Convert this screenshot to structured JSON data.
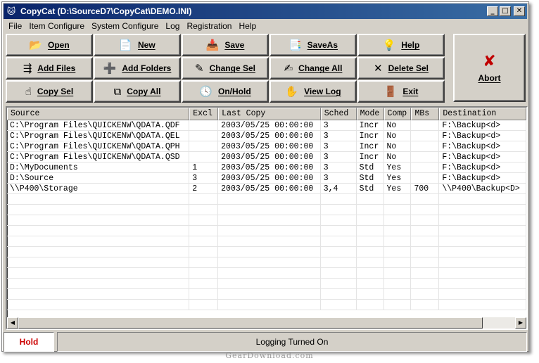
{
  "window": {
    "title": "CopyCat  (D:\\SourceD7\\CopyCat\\DEMO.INI)",
    "minimize": "_",
    "maximize": "□",
    "close": "✕"
  },
  "menu": [
    "File",
    "Item Configure",
    "System Configure",
    "Log",
    "Registration",
    "Help"
  ],
  "toolbar": {
    "open": "Open",
    "new": "New",
    "save": "Save",
    "saveas": "SaveAs",
    "help": "Help",
    "add_files": "Add Files",
    "add_folders": "Add Folders",
    "change_sel": "Change Sel",
    "change_all": "Change All",
    "delete_sel": "Delete Sel",
    "copy_sel": "Copy Sel",
    "copy_all": "Copy All",
    "onhold": "On/Hold",
    "view_log": "View Log",
    "exit": "Exit",
    "abort": "Abort"
  },
  "list": {
    "headers": [
      "Source",
      "Excl",
      "Last Copy",
      "Sched",
      "Mode",
      "Comp",
      "MBs",
      "Destination"
    ],
    "rows": [
      [
        "C:\\Program Files\\QUICKENW\\QDATA.QDF",
        "",
        "2003/05/25 00:00:00",
        "3",
        "Incr",
        "No",
        "",
        "F:\\Backup<d>"
      ],
      [
        "C:\\Program Files\\QUICKENW\\QDATA.QEL",
        "",
        "2003/05/25 00:00:00",
        "3",
        "Incr",
        "No",
        "",
        "F:\\Backup<d>"
      ],
      [
        "C:\\Program Files\\QUICKENW\\QDATA.QPH",
        "",
        "2003/05/25 00:00:00",
        "3",
        "Incr",
        "No",
        "",
        "F:\\Backup<d>"
      ],
      [
        "C:\\Program Files\\QUICKENW\\QDATA.QSD",
        "",
        "2003/05/25 00:00:00",
        "3",
        "Incr",
        "No",
        "",
        "F:\\Backup<d>"
      ],
      [
        "D:\\MyDocuments",
        "1",
        "2003/05/25 00:00:00",
        "3",
        "Std",
        "Yes",
        "",
        "F:\\Backup<d>"
      ],
      [
        "D:\\Source",
        "3",
        "2003/05/25 00:00:00",
        "3",
        "Std",
        "Yes",
        "",
        "F:\\Backup<d>"
      ],
      [
        "\\\\P400\\Storage",
        "2",
        "2003/05/25 00:00:00",
        "3,4",
        "Std",
        "Yes",
        "700",
        "\\\\P400\\Backup<D>"
      ]
    ]
  },
  "status": {
    "hold": "Hold",
    "message": "Logging Turned On"
  },
  "watermark": "GearDownload.com"
}
